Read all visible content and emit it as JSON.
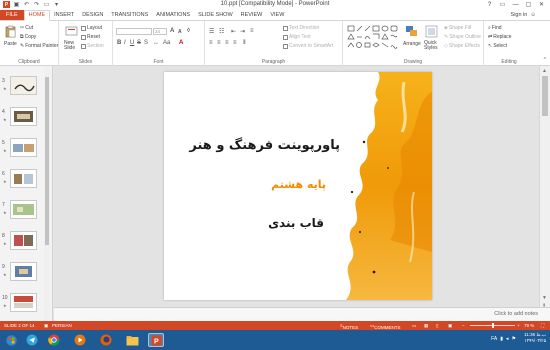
{
  "window": {
    "title": "10.ppt [Compatibility Mode] - PowerPoint",
    "controls": [
      "?",
      "▭",
      "—",
      "▢",
      "✕"
    ]
  },
  "qat": {
    "app_icon_label": "P"
  },
  "tabs": [
    "FILE",
    "HOME",
    "INSERT",
    "DESIGN",
    "TRANSITIONS",
    "ANIMATIONS",
    "SLIDE SHOW",
    "REVIEW",
    "VIEW"
  ],
  "sign_in": "Sign in",
  "ribbon": {
    "clipboard": {
      "paste": "Paste",
      "cut": "Cut",
      "copy": "Copy",
      "format_painter": "Format Painter",
      "label": "Clipboard"
    },
    "slides": {
      "new_slide": "New Slide",
      "layout": "Layout",
      "reset": "Reset",
      "section": "Section",
      "label": "Slides"
    },
    "font": {
      "font_size": "24",
      "bold": "B",
      "italic": "I",
      "underline": "U",
      "strike": "S",
      "label": "Font"
    },
    "paragraph": {
      "text_direction": "Text Direction",
      "align_text": "Align Text",
      "convert_smartart": "Convert to SmartArt",
      "label": "Paragraph"
    },
    "drawing": {
      "arrange": "Arrange",
      "quick_styles": "Quick Styles",
      "shape_fill": "Shape Fill",
      "shape_outline": "Shape Outline",
      "shape_effects": "Shape Effects",
      "label": "Drawing"
    },
    "editing": {
      "find": "Find",
      "replace": "Replace",
      "select": "Select",
      "label": "Editing"
    }
  },
  "thumbnails": [
    {
      "num": "3"
    },
    {
      "num": "4"
    },
    {
      "num": "5"
    },
    {
      "num": "6"
    },
    {
      "num": "7"
    },
    {
      "num": "8"
    },
    {
      "num": "9"
    },
    {
      "num": "10"
    }
  ],
  "slide": {
    "title": "پاورپوینت فرهنگ و هنر",
    "subtitle": "پایه هشتم",
    "topic": "قاب بندی",
    "colors": {
      "accent": "#f28c00",
      "paint": "#f4a300"
    }
  },
  "notes_placeholder": "Click to add notes",
  "status": {
    "slide_info": "SLIDE 2 OF 14",
    "language": "PERSIAN",
    "notes": "NOTES",
    "comments": "COMMENTS",
    "zoom": "79 %"
  },
  "taskbar": {
    "time": "11:36 ب.ظ",
    "date": "۱۳۹۹/۰۳/۲۵",
    "lang": "FA"
  },
  "colors": {
    "brand": "#d24726",
    "taskbar": "#1e5a93"
  }
}
